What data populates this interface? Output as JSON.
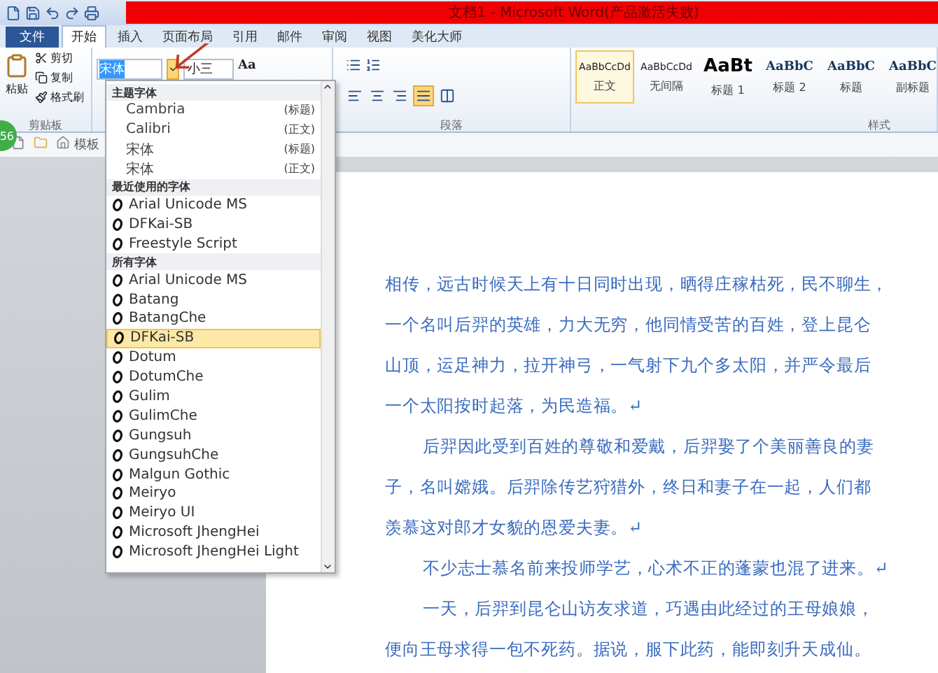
{
  "window": {
    "title": "文档1 - Microsoft Word(产品激活失败)"
  },
  "tabs": [
    {
      "label": "文件",
      "kind": "file",
      "selected": false
    },
    {
      "label": "开始",
      "kind": "tab",
      "selected": true
    },
    {
      "label": "插入",
      "kind": "tab",
      "selected": false
    },
    {
      "label": "页面布局",
      "kind": "tab",
      "selected": false
    },
    {
      "label": "引用",
      "kind": "tab",
      "selected": false
    },
    {
      "label": "邮件",
      "kind": "tab",
      "selected": false
    },
    {
      "label": "审阅",
      "kind": "tab",
      "selected": false
    },
    {
      "label": "视图",
      "kind": "tab",
      "selected": false
    },
    {
      "label": "美化大师",
      "kind": "tab",
      "selected": false
    }
  ],
  "clipboard": {
    "paste": "粘贴",
    "cut": "剪切",
    "copy": "复制",
    "format_painter": "格式刷",
    "group_label": "剪贴板"
  },
  "font": {
    "name": "宋体",
    "size": "小三",
    "change_case": "Aa"
  },
  "paragraph": {
    "group_label": "段落",
    "alignments": [
      {
        "selected": false
      },
      {
        "selected": false
      },
      {
        "selected": false
      },
      {
        "selected": true
      },
      {
        "selected": false
      }
    ]
  },
  "styles": {
    "group_label": "样式",
    "items": [
      {
        "sample": "AaBbCcDd",
        "label": "正文",
        "kind": "body",
        "selected": true
      },
      {
        "sample": "AaBbCcDd",
        "label": "无间隔",
        "kind": "body",
        "selected": false
      },
      {
        "sample": "AaBt",
        "label": "标题 1",
        "kind": "heading1",
        "selected": false
      },
      {
        "sample": "AaBbC",
        "label": "标题 2",
        "kind": "heading",
        "selected": false
      },
      {
        "sample": "AaBbC",
        "label": "标题",
        "kind": "heading",
        "selected": false
      },
      {
        "sample": "AaBbC",
        "label": "副标题",
        "kind": "heading",
        "selected": false
      }
    ]
  },
  "speed_badge": "56",
  "sub_toolbar": {
    "label": "模板"
  },
  "font_menu": {
    "sections": [
      {
        "title": "主题字体",
        "items": [
          {
            "name": "Cambria",
            "tag": "(标题)",
            "kind": "theme",
            "selected": false
          },
          {
            "name": "Calibri",
            "tag": "(正文)",
            "kind": "theme",
            "selected": false
          },
          {
            "name": "宋体",
            "tag": "(标题)",
            "kind": "theme",
            "selected": false
          },
          {
            "name": "宋体",
            "tag": "(正文)",
            "kind": "theme",
            "selected": false
          }
        ]
      },
      {
        "title": "最近使用的字体",
        "items": [
          {
            "name": "Arial Unicode MS",
            "kind": "font",
            "selected": false
          },
          {
            "name": "DFKai-SB",
            "kind": "font",
            "selected": false
          },
          {
            "name": "Freestyle Script",
            "kind": "font",
            "selected": false
          }
        ]
      },
      {
        "title": "所有字体",
        "items": [
          {
            "name": "Arial Unicode MS",
            "kind": "font",
            "selected": false
          },
          {
            "name": "Batang",
            "kind": "font",
            "selected": false
          },
          {
            "name": "BatangChe",
            "kind": "font",
            "selected": false
          },
          {
            "name": "DFKai-SB",
            "kind": "font",
            "selected": true
          },
          {
            "name": "Dotum",
            "kind": "font",
            "selected": false
          },
          {
            "name": "DotumChe",
            "kind": "font",
            "selected": false
          },
          {
            "name": "Gulim",
            "kind": "font",
            "selected": false
          },
          {
            "name": "GulimChe",
            "kind": "font",
            "selected": false
          },
          {
            "name": "Gungsuh",
            "kind": "font",
            "selected": false
          },
          {
            "name": "GungsuhChe",
            "kind": "font",
            "selected": false
          },
          {
            "name": "Malgun Gothic",
            "kind": "font",
            "selected": false
          },
          {
            "name": "Meiryo",
            "kind": "font",
            "selected": false
          },
          {
            "name": "Meiryo UI",
            "kind": "font",
            "selected": false
          },
          {
            "name": "Microsoft JhengHei",
            "kind": "font",
            "selected": false
          },
          {
            "name": "Microsoft JhengHei Light",
            "kind": "font",
            "selected": false
          }
        ]
      }
    ]
  },
  "document": {
    "paragraphs": [
      {
        "indent": false,
        "lines": [
          "相传，远古时候天上有十日同时出现，晒得庄稼枯死，民不聊生，",
          "一个名叫后羿的英雄，力大无穷，他同情受苦的百姓，登上昆仑",
          "山顶，运足神力，拉开神弓，一气射下九个多太阳，并严令最后",
          "一个太阳按时起落，为民造福。↵"
        ]
      },
      {
        "indent": true,
        "lines": [
          "后羿因此受到百姓的尊敬和爱戴，后羿娶了个美丽善良的妻",
          "子，名叫嫦娥。后羿除传艺狩猎外，终日和妻子在一起，人们都",
          "羡慕这对郎才女貌的恩爱夫妻。↵"
        ]
      },
      {
        "indent": true,
        "lines": [
          "不少志士慕名前来投师学艺，心术不正的蓬蒙也混了进来。↵"
        ]
      },
      {
        "indent": true,
        "lines": [
          "一天，后羿到昆仑山访友求道，巧遇由此经过的王母娘娘，",
          "便向王母求得一包不死药。据说，服下此药，能即刻升天成仙。"
        ]
      }
    ]
  }
}
